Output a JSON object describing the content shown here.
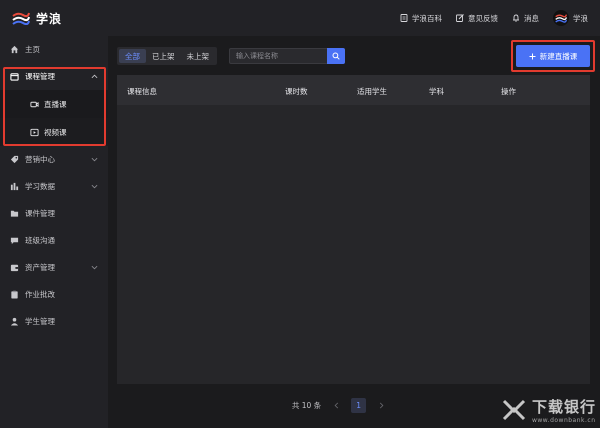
{
  "app": {
    "logo_text": "学浪"
  },
  "header": {
    "links": [
      {
        "label": "学浪百科",
        "icon": "document-icon"
      },
      {
        "label": "意见反馈",
        "icon": "edit-icon"
      },
      {
        "label": "消息",
        "icon": "bell-icon"
      }
    ],
    "user_name": "学浪"
  },
  "sidebar": {
    "items": [
      {
        "label": "主页",
        "icon": "home-icon"
      },
      {
        "label": "课程管理",
        "icon": "calendar-icon",
        "expanded": true
      },
      {
        "label": "直播课",
        "icon": "video-camera-icon"
      },
      {
        "label": "视频课",
        "icon": "play-icon"
      },
      {
        "label": "营销中心",
        "icon": "tag-icon"
      },
      {
        "label": "学习数据",
        "icon": "bar-chart-icon"
      },
      {
        "label": "课件管理",
        "icon": "folder-icon"
      },
      {
        "label": "班级沟通",
        "icon": "chat-icon"
      },
      {
        "label": "资产管理",
        "icon": "wallet-icon"
      },
      {
        "label": "作业批改",
        "icon": "clipboard-icon"
      },
      {
        "label": "学生管理",
        "icon": "users-icon"
      }
    ]
  },
  "toolbar": {
    "filters": [
      "全部",
      "已上架",
      "未上架"
    ],
    "active_filter": "全部",
    "search_placeholder": "输入课程名称",
    "new_button_label": "新建直播课"
  },
  "table": {
    "columns": [
      "课程信息",
      "课时数",
      "适用学生",
      "学科",
      "操作"
    ],
    "rows": []
  },
  "pagination": {
    "total_text": "共 10 条",
    "current_page": "1"
  },
  "watermark": {
    "title": "下载银行",
    "subtitle": "www.downbank.cn"
  },
  "colors": {
    "accent": "#4a72f5",
    "highlight": "#e23b2f",
    "background": "#1b1b1d",
    "sidebar": "#222226"
  }
}
